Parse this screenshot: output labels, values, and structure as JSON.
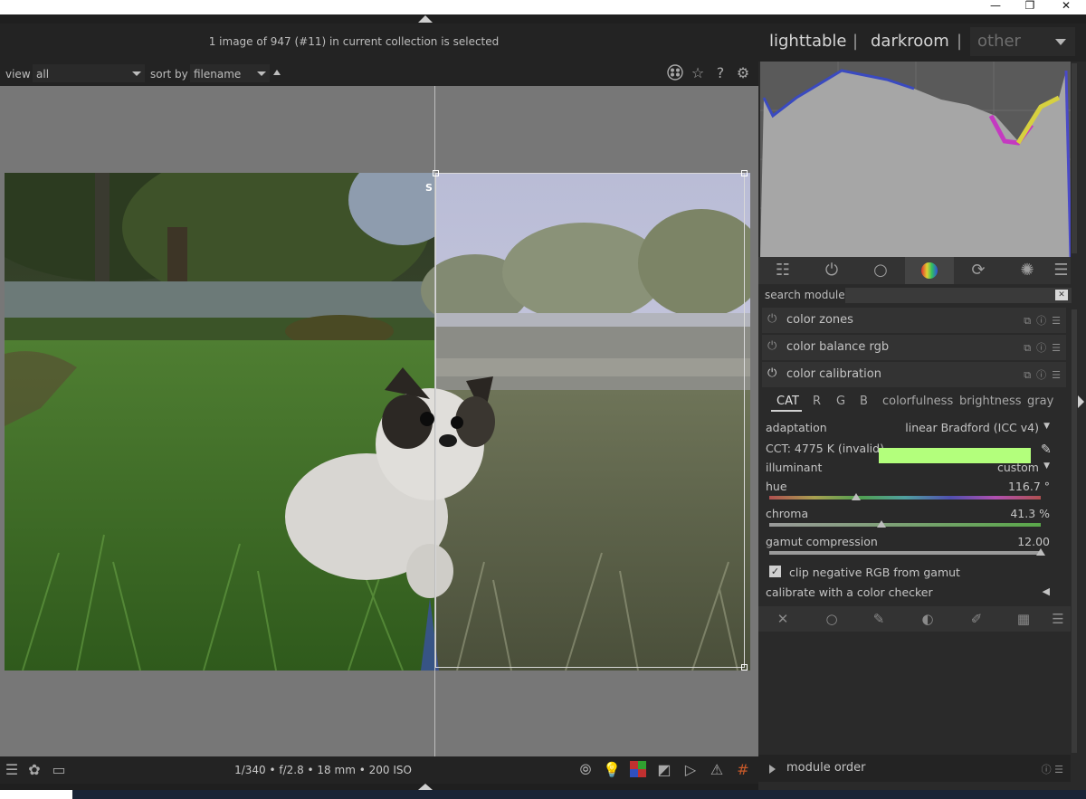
{
  "window": {
    "minimize": "—",
    "restore": "❐",
    "close": "✕"
  },
  "header": {
    "selected_info": "1 image of 947 (#11) in current collection is selected"
  },
  "views": {
    "lighttable": "lighttable",
    "separator": "|",
    "darkroom": "darkroom",
    "other": "other"
  },
  "filterbar": {
    "view_label": "view",
    "view_value": "all",
    "sort_label": "sort by",
    "sort_value": "filename"
  },
  "top_icons": {
    "color_labels": "color-labels-icon",
    "star": "star-icon",
    "help": "help-icon",
    "settings": "gear-icon"
  },
  "photo": {
    "split_label": "S"
  },
  "bottombar": {
    "exif": "1/340 • f/2.8 • 18 mm • 200 ISO"
  },
  "right_panel": {
    "search_label": "search module",
    "modules": [
      {
        "name": "color zones"
      },
      {
        "name": "color balance rgb"
      },
      {
        "name": "color calibration"
      }
    ],
    "calibration": {
      "tabs": [
        "CAT",
        "R",
        "G",
        "B",
        "colorfulness",
        "brightness",
        "gray"
      ],
      "active_tab": "CAT",
      "adaptation_label": "adaptation",
      "adaptation_value": "linear Bradford (ICC v4)",
      "cct_label": "CCT: 4775 K (invalid)",
      "cct_color": "#b3ff7c",
      "illuminant_label": "illuminant",
      "illuminant_value": "custom",
      "hue_label": "hue",
      "hue_value": "116.7 °",
      "hue_level": 0.32,
      "chroma_label": "chroma",
      "chroma_value": "41.3 %",
      "chroma_level": 0.413,
      "gamut_label": "gamut compression",
      "gamut_value": "12.00",
      "gamut_level": 1.0,
      "clip_label": "clip negative RGB from gamut",
      "clip_checked": true,
      "calibrate_label": "calibrate with a color checker"
    },
    "module_order_label": "module order"
  }
}
